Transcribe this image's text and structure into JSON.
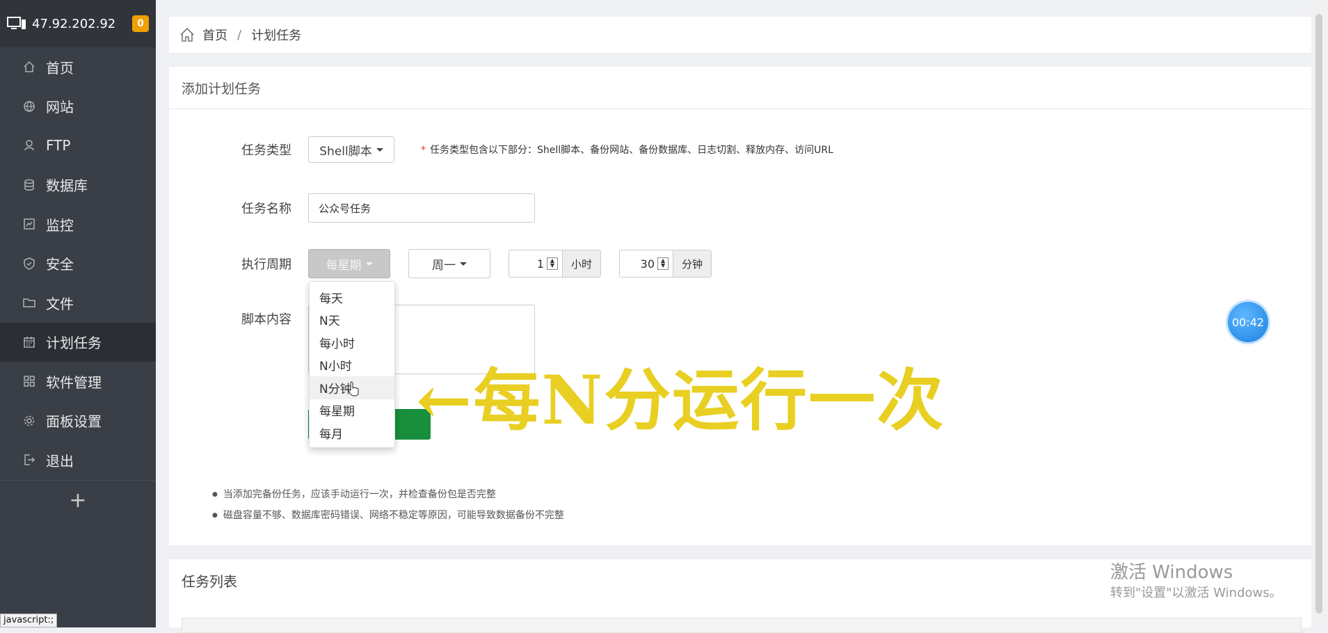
{
  "sidebar": {
    "server_ip": "47.92.202.92",
    "notification_count": "0",
    "items": [
      {
        "label": "首页",
        "icon": "home-icon"
      },
      {
        "label": "网站",
        "icon": "globe-icon"
      },
      {
        "label": "FTP",
        "icon": "ftp-icon"
      },
      {
        "label": "数据库",
        "icon": "database-icon"
      },
      {
        "label": "监控",
        "icon": "monitor-icon"
      },
      {
        "label": "安全",
        "icon": "shield-icon"
      },
      {
        "label": "文件",
        "icon": "folder-icon"
      },
      {
        "label": "计划任务",
        "icon": "calendar-icon",
        "active": true
      },
      {
        "label": "软件管理",
        "icon": "grid-icon"
      },
      {
        "label": "面板设置",
        "icon": "gear-icon"
      },
      {
        "label": "退出",
        "icon": "logout-icon"
      }
    ],
    "add_label": "+",
    "status_tooltip": "javascript:;"
  },
  "breadcrumb": {
    "home": "首页",
    "separator": "/",
    "current": "计划任务"
  },
  "form": {
    "title": "添加计划任务",
    "task_type_label": "任务类型",
    "task_type_value": "Shell脚本",
    "task_type_hint_star": "*",
    "task_type_hint": "任务类型包含以下部分：Shell脚本、备份网站、备份数据库、日志切割、释放内存、访问URL",
    "task_name_label": "任务名称",
    "task_name_value": "公众号任务",
    "cycle_label": "执行周期",
    "cycle_value": "每星期",
    "weekday_value": "周一",
    "hour_value": "1",
    "hour_unit": "小时",
    "minute_value": "30",
    "minute_unit": "分钟",
    "script_label": "脚本内容",
    "cycle_options": [
      "每天",
      "N天",
      "每小时",
      "N小时",
      "N分钟",
      "每星期",
      "每月"
    ],
    "hovered_option": "N分钟"
  },
  "notes": [
    "当添加完备份任务，应该手动运行一次，并检查备份包是否完整",
    "磁盘容量不够、数据库密码错误、网络不稳定等原因，可能导致数据备份不完整"
  ],
  "annotation": "←每N分运行一次",
  "timer": "00:42",
  "task_list": {
    "title": "任务列表"
  },
  "watermark": {
    "line1": "激活 Windows",
    "line2": "转到\"设置\"以激活 Windows。"
  },
  "colors": {
    "sidebar_bg": "#3a3f47",
    "submit_green": "#188f3c",
    "badge_orange": "#f0a000",
    "annotation_yellow": "#e8cf22",
    "timer_blue": "#1f7fe0"
  }
}
